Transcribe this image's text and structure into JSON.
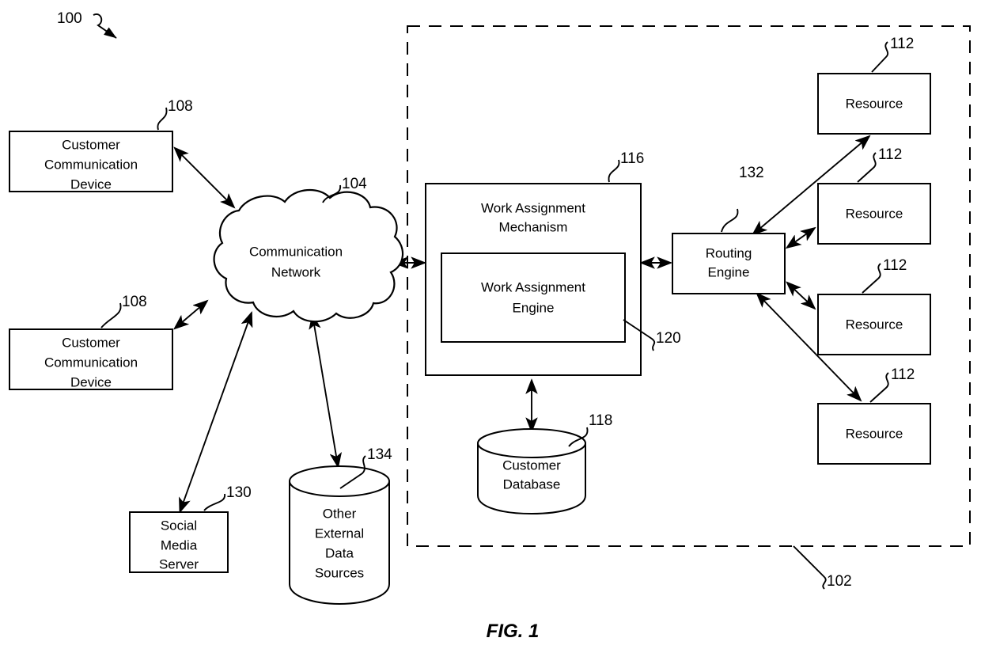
{
  "figure": {
    "caption": "FIG. 1",
    "overall_ref": "100",
    "contact_center_ref": "102"
  },
  "nodes": {
    "customer_device_1": {
      "label_lines": [
        "Customer",
        "Communication",
        "Device"
      ],
      "line1": "Customer",
      "line2": "Communication",
      "line3": "Device",
      "ref": "108"
    },
    "customer_device_2": {
      "line1": "Customer",
      "line2": "Communication",
      "line3": "Device",
      "ref": "108"
    },
    "communication_network": {
      "line1": "Communication",
      "line2": "Network",
      "ref": "104"
    },
    "social_media_server": {
      "line1": "Social",
      "line2": "Media",
      "line3": "Server",
      "ref": "130"
    },
    "other_external_data_sources": {
      "line1": "Other",
      "line2": "External",
      "line3": "Data",
      "line4": "Sources",
      "ref": "134"
    },
    "work_assignment_mechanism": {
      "line1": "Work Assignment",
      "line2": "Mechanism",
      "ref": "116"
    },
    "work_assignment_engine": {
      "line1": "Work Assignment",
      "line2": "Engine",
      "ref": "120"
    },
    "customer_database": {
      "line1": "Customer",
      "line2": "Database",
      "ref": "118"
    },
    "routing_engine": {
      "line1": "Routing",
      "line2": "Engine",
      "ref": "132"
    },
    "resource_1": {
      "label": "Resource",
      "ref": "112"
    },
    "resource_2": {
      "label": "Resource",
      "ref": "112"
    },
    "resource_3": {
      "label": "Resource",
      "ref": "112"
    },
    "resource_4": {
      "label": "Resource",
      "ref": "112"
    }
  },
  "colors": {
    "ink": "#000000",
    "paper": "#ffffff"
  }
}
